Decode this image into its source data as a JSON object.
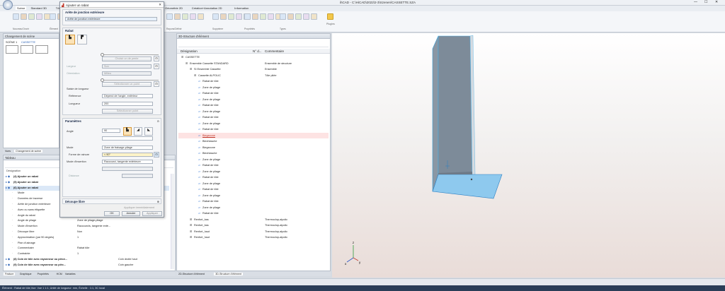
{
  "window": {
    "title": "ihCAD - C:\\HiCAD\\2022\\2-3\\Szenen\\CASSETTE.SZA"
  },
  "menu_tabs": [
    "Scène",
    "Standard 3D",
    "Tôle",
    "Soyouse",
    "Vues",
    "Éditer",
    "Simplifier",
    "Élément 3D",
    "Géométrie 2D",
    "Création+Annotation 2D",
    "Information"
  ],
  "ribbon_groups": [
    "Nouveau/Ouvrir",
    "Élément",
    "Traitement",
    "Rayons/Définir",
    "Supprimer",
    "Propriétés",
    "Types"
  ],
  "ribbon_right_label": "Plugins",
  "scene_panel": {
    "title": "Changement de scène",
    "item_label": "SCÈNE 1",
    "item_sub": "CASSETTE"
  },
  "left_tabs": [
    "Vues",
    "Changement de scène"
  ],
  "props_panel": {
    "header": "Tableau",
    "col_label": "Désignation",
    "rows": [
      {
        "label": "(4) Ajouter un rabat",
        "value": ""
      },
      {
        "label": "(5) Ajouter un rabat",
        "value": ""
      },
      {
        "label": "(6) Ajouter un rabat",
        "value": ""
      },
      {
        "label": "Mode",
        "value": ""
      },
      {
        "label": "Données de traverse",
        "value": ""
      },
      {
        "label": "Arête de jonction extérieure",
        "value": ""
      },
      {
        "label": "Avec ou sans étiquette",
        "value": ""
      },
      {
        "label": "Angle du rabat",
        "value": "Angle du rabat de jonction"
      },
      {
        "label": "Angle de pliage",
        "value": "Zone de pliage-pliage"
      },
      {
        "label": "Mode d'insertion",
        "value": "Raccourcis, tangente exté..."
      },
      {
        "label": "Découpe libre",
        "value": "Non"
      },
      {
        "label": "Approximation (par 90 degrés)",
        "value": "1"
      },
      {
        "label": "Plan d'usinage",
        "value": ""
      },
      {
        "label": "Commentaire",
        "value": "Rabat tôle"
      },
      {
        "label": "Contrainte",
        "value": "1"
      },
      {
        "label": "(8) Coin de tôle avec rayonneur ou pièce...",
        "value": "Coin droite haut"
      },
      {
        "label": "(9) Coin de tôle avec rayonneur ou pièc...",
        "value": "Coin gauche"
      }
    ],
    "bottom_tabs": [
      "Feature",
      "Graphique",
      "Propriétés",
      "HCM",
      "Variables"
    ]
  },
  "dialog": {
    "title": "Ajouter un rabat",
    "edge_group": "Arête de jonction extérieure",
    "edge_field": "Arête de jonction extérieure",
    "rabat_group": "Rabat",
    "slider1_btn": "Choisir un de pente",
    "largeur_label": "Largeur",
    "largeur_value": "Son",
    "orientation_label": "Orientation",
    "orientation_value": "Milieu",
    "slider2_btn": "Sélectionner un point",
    "longueur_group": "Saisie de longueur",
    "reference_label": "Référence",
    "reference_value": "Dépend de l'angle, extérieur",
    "longueur_label": "Longueur",
    "longueur_value": "200",
    "grey_btn": "Sélectionner point",
    "params_group": "Paramètres",
    "angle_label": "Angle",
    "angle_value": "90",
    "mode_label": "Mode",
    "mode_value": "Zone de fraisage-pliage",
    "forme_label": "Forme de rainure",
    "forme_value": "< 90°",
    "insertion_label": "Mode d'insertion",
    "insertion_value": "Raccourci, tangente extérieure",
    "distance_label": "Distance",
    "decoupe_group": "Découpe libre",
    "apply_immediate": "Appliquer immédiatement",
    "ok_label": "OK",
    "cancel_label": "Annuler",
    "apply_label": "Appliquer"
  },
  "structure_panel": {
    "title": "3D-Structure d'élément",
    "col1": "Désignation",
    "col2": "N° d...",
    "col3": "Commentaire",
    "rows": [
      {
        "indent": 0,
        "name": "CASSETTE",
        "comment": ""
      },
      {
        "indent": 1,
        "name": "Ensemble Cassette STANDARD",
        "comment": "Ensemble de structure"
      },
      {
        "indent": 2,
        "name": "SI Ensemble Cassette",
        "comment": "Ensemble"
      },
      {
        "indent": 3,
        "name": "Cassette ALPOLIC",
        "comment": "Tôle pliée"
      },
      {
        "indent": 4,
        "name": "Rabat de tôle",
        "comment": ""
      },
      {
        "indent": 4,
        "name": "Zone de pliage",
        "comment": ""
      },
      {
        "indent": 4,
        "name": "Rabat de tôle",
        "comment": ""
      },
      {
        "indent": 4,
        "name": "Zone de pliage",
        "comment": ""
      },
      {
        "indent": 4,
        "name": "Rabat de tôle",
        "comment": ""
      },
      {
        "indent": 4,
        "name": "Zone de pliage",
        "comment": ""
      },
      {
        "indent": 4,
        "name": "Rabat de tôle",
        "comment": ""
      },
      {
        "indent": 4,
        "name": "Zone de pliage",
        "comment": ""
      },
      {
        "indent": 4,
        "name": "Rabat de tôle",
        "comment": ""
      },
      {
        "indent": 4,
        "name": "Biegezone",
        "comment": ""
      },
      {
        "indent": 4,
        "name": "Blechlasche",
        "comment": ""
      },
      {
        "indent": 4,
        "name": "Biegezone",
        "comment": ""
      },
      {
        "indent": 4,
        "name": "Blechlasche",
        "comment": ""
      },
      {
        "indent": 4,
        "name": "Zone de pliage",
        "comment": ""
      },
      {
        "indent": 4,
        "name": "Rabat de tôle",
        "comment": ""
      },
      {
        "indent": 4,
        "name": "Zone de pliage",
        "comment": ""
      },
      {
        "indent": 4,
        "name": "Rabat de tôle",
        "comment": ""
      },
      {
        "indent": 4,
        "name": "Zone de pliage",
        "comment": ""
      },
      {
        "indent": 4,
        "name": "Rabat de tôle",
        "comment": ""
      },
      {
        "indent": 4,
        "name": "Zone de pliage",
        "comment": ""
      },
      {
        "indent": 4,
        "name": "Rabat de tôle",
        "comment": ""
      },
      {
        "indent": 4,
        "name": "Zone de pliage",
        "comment": ""
      },
      {
        "indent": 4,
        "name": "Rabat de tôle",
        "comment": ""
      },
      {
        "indent": 2,
        "name": "Renfort_bas",
        "comment": "Thermoclop-alpolic"
      },
      {
        "indent": 2,
        "name": "Renfort_bas",
        "comment": "Thermoclop-alpolic"
      },
      {
        "indent": 2,
        "name": "Renfort_haut",
        "comment": "Thermoclop-alpolic"
      },
      {
        "indent": 2,
        "name": "Renfort_haut",
        "comment": "Thermoclop-alpolic"
      }
    ],
    "bottom_tabs": [
      "2D-Structure d'élément",
      "3D-Structure d'élément"
    ]
  },
  "axis_labels": {
    "x": "x",
    "y": "y",
    "z": "z"
  },
  "status": {
    "text": "Élément : Rabat de tôle,Vue: Vue 1 1:1, Unité de longueur: mm, Échelle : 1:1, 3C local"
  },
  "colors": {
    "accent": "#4a90d9",
    "status_bg": "#2b3d57",
    "sheet_face": "#7d8b99",
    "flange": "#8ec9ee"
  }
}
